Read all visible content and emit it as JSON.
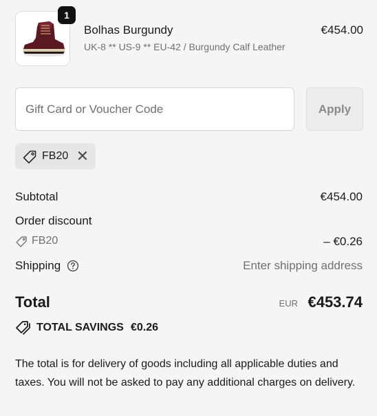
{
  "product": {
    "quantity": "1",
    "name": "Bolhas Burgundy",
    "variant": "UK-8 ** US-9 ** EU-42 / Burgundy Calf Leather",
    "price": "€454.00",
    "image_icon": "burgundy-boot-image"
  },
  "discount_form": {
    "placeholder": "Gift Card or Voucher Code",
    "value": "",
    "apply_label": "Apply"
  },
  "applied_code": {
    "code": "FB20",
    "icon": "tag-icon",
    "remove_icon": "close-icon"
  },
  "summary": {
    "subtotal_label": "Subtotal",
    "subtotal_value": "€454.00",
    "order_discount_label": "Order discount",
    "discount_code": "FB20",
    "discount_value": "– €0.26",
    "shipping_label": "Shipping",
    "shipping_value": "Enter shipping address"
  },
  "total": {
    "label": "Total",
    "currency": "EUR",
    "amount": "€453.74"
  },
  "savings": {
    "label": "TOTAL SAVINGS",
    "amount": "€0.26"
  },
  "note": "The total is for delivery of goods including all applicable duties and taxes. You will not be asked to pay any additional charges on delivery.",
  "colors": {
    "background": "#f5f5f5",
    "text": "#1a1a1a",
    "muted": "#707070",
    "chip": "#e6e6e6",
    "badge": "#111111"
  }
}
